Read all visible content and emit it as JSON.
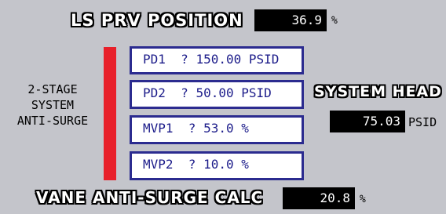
{
  "ls_prv": {
    "label": "LS PRV POSITION",
    "value": "36.9",
    "unit": "%"
  },
  "anti_surge": {
    "line1": "2-STAGE",
    "line2": "SYSTEM",
    "line3": "ANTI-SURGE",
    "bar_color": "#e8202a"
  },
  "params": [
    {
      "label": "PD1",
      "sep": "?",
      "value": "150.00",
      "unit": "PSID"
    },
    {
      "label": "PD2",
      "sep": "?",
      "value": "50.00",
      "unit": "PSID"
    },
    {
      "label": "MVP1",
      "sep": "?",
      "value": "53.0",
      "unit": "%"
    },
    {
      "label": "MVP2",
      "sep": "?",
      "value": "10.0",
      "unit": "%"
    }
  ],
  "system_head": {
    "label": "SYSTEM HEAD",
    "value": "75.03",
    "unit": "PSID"
  },
  "vane": {
    "label": "VANE ANTI-SURGE CALC",
    "value": "20.8",
    "unit": "%"
  }
}
